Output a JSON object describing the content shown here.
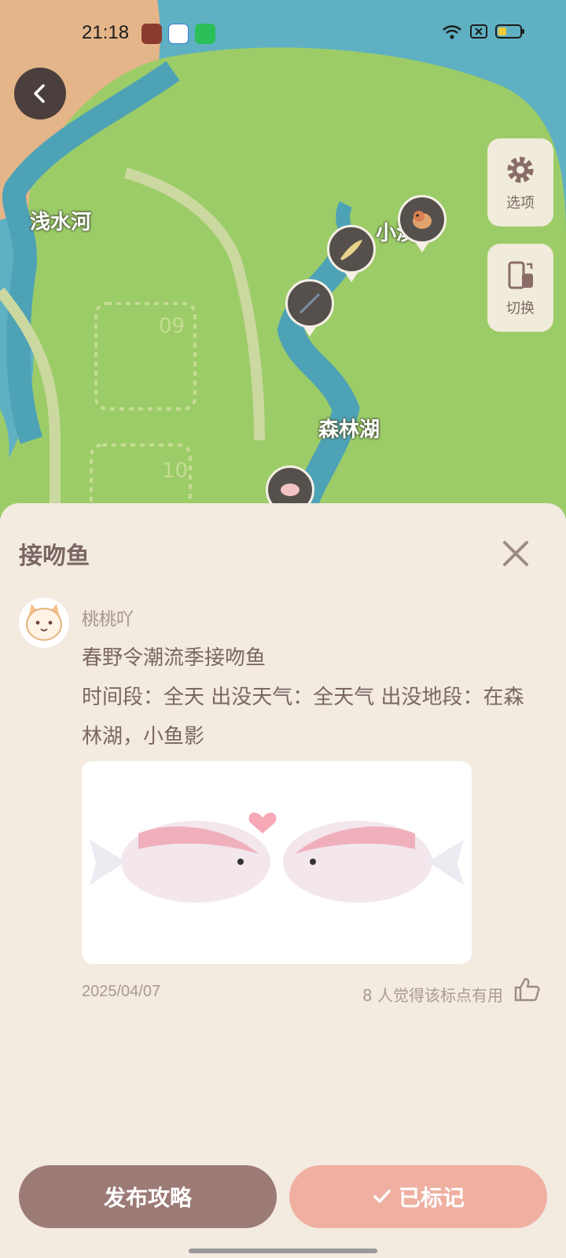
{
  "status_bar": {
    "time": "21:18"
  },
  "map": {
    "labels": {
      "river": "浅水河",
      "lake": "森林湖",
      "stream": "小溪",
      "zone_09": "09",
      "zone_10": "10"
    },
    "side_buttons": {
      "options": "选项",
      "switch": "切换"
    }
  },
  "sheet": {
    "title": "接吻鱼",
    "author": "桃桃吖",
    "line1": "春野令潮流季接吻鱼",
    "line2": "时间段：全天 出没天气：全天气 出没地段：在森林湖，小鱼影",
    "date": "2025/04/07",
    "useful_text": "8 人觉得该标点有用"
  },
  "actions": {
    "publish": "发布攻略",
    "marked": "已标记"
  },
  "colors": {
    "accent_brown": "#9c7a76",
    "accent_pink": "#efb0a2",
    "sheet_bg": "#f3eae0"
  }
}
